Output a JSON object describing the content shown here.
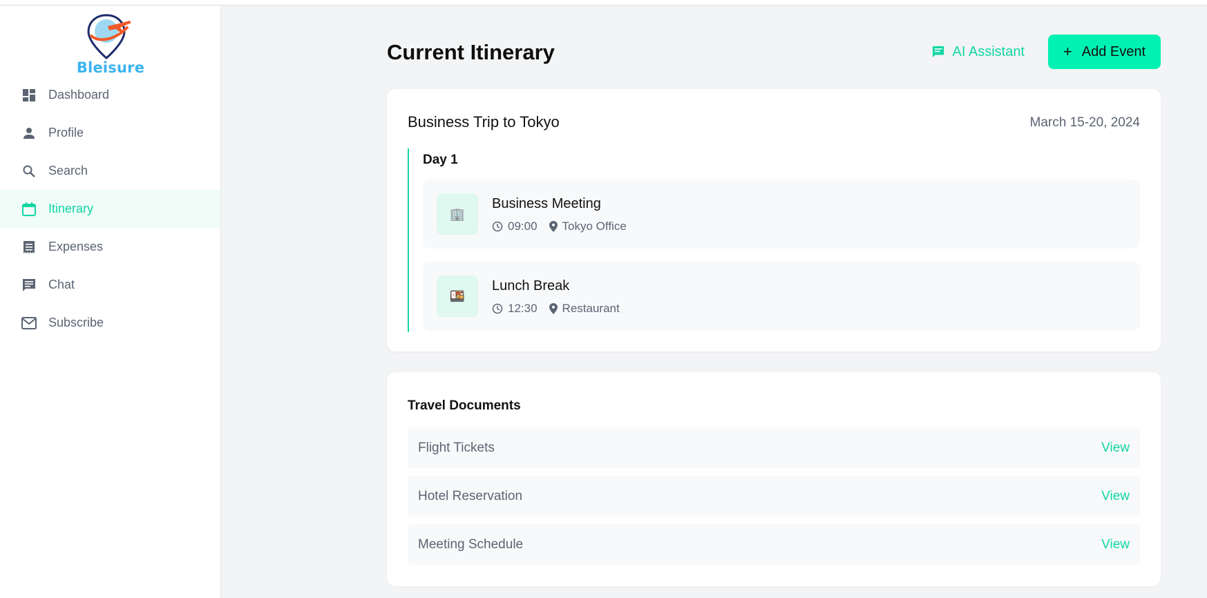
{
  "app": {
    "brand": "Bleisure"
  },
  "sidebar": {
    "items": [
      {
        "label": "Dashboard",
        "icon": "dashboard-icon"
      },
      {
        "label": "Profile",
        "icon": "person-icon"
      },
      {
        "label": "Search",
        "icon": "search-icon"
      },
      {
        "label": "Itinerary",
        "icon": "calendar-icon",
        "active": true
      },
      {
        "label": "Expenses",
        "icon": "receipt-icon"
      },
      {
        "label": "Chat",
        "icon": "chat-icon"
      },
      {
        "label": "Subscribe",
        "icon": "mail-icon"
      }
    ]
  },
  "header": {
    "title": "Current Itinerary",
    "ai_label": "AI Assistant",
    "add_label": "Add Event",
    "add_symbol": "+"
  },
  "trip": {
    "title": "Business Trip to Tokyo",
    "dates": "March 15-20, 2024",
    "days": [
      {
        "label": "Day 1",
        "events": [
          {
            "emoji": "🏢",
            "title": "Business Meeting",
            "time": "09:00",
            "location": "Tokyo Office"
          },
          {
            "emoji": "🍱",
            "title": "Lunch Break",
            "time": "12:30",
            "location": "Restaurant"
          }
        ]
      }
    ]
  },
  "documents": {
    "title": "Travel Documents",
    "items": [
      {
        "name": "Flight Tickets",
        "action": "View"
      },
      {
        "name": "Hotel Reservation",
        "action": "View"
      },
      {
        "name": "Meeting Schedule",
        "action": "View"
      }
    ]
  },
  "colors": {
    "accent": "#11d6a4",
    "button": "#00f2b2",
    "muted": "#5b6472"
  }
}
